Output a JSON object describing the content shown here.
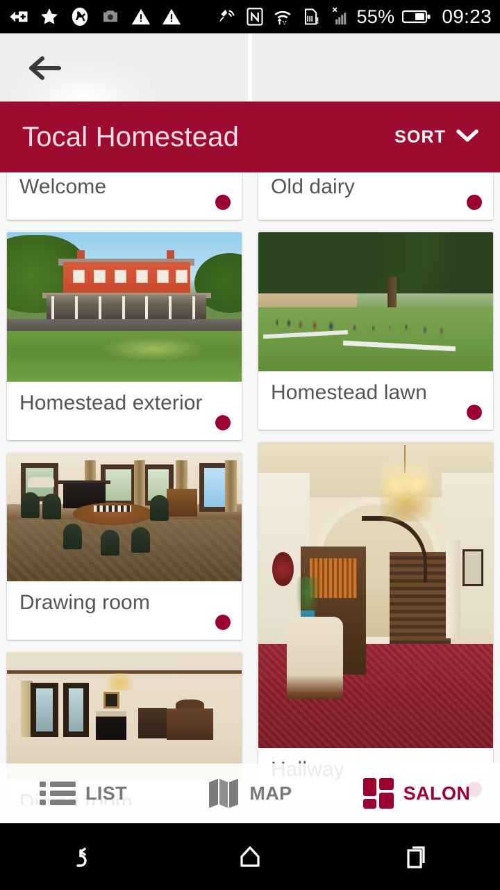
{
  "status_bar": {
    "left_icons": [
      "sim-card-add-icon",
      "star-icon",
      "do-not-disturb-icon",
      "camera-icon",
      "warning-icon",
      "warning-icon"
    ],
    "right_icons": [
      "cast-screen-icon",
      "nfc-icon",
      "wifi-data-transfer-icon",
      "sd-card-alert-icon",
      "signal-no-service-icon"
    ],
    "battery_percent": "55%",
    "battery_icon": "battery-icon",
    "time": "09:23"
  },
  "top_bar": {
    "back_icon": "back-arrow-icon"
  },
  "header": {
    "title": "Tocal Homestead",
    "sort_label": "SORT",
    "sort_icon": "chevron-down-icon",
    "background_color": "#9d0b2f"
  },
  "theme": {
    "accent": "#9b0030",
    "header": "#9d0b2f",
    "page_background": "#f7f7f7",
    "card_background": "#ffffff",
    "card_title_color": "#555555",
    "tab_inactive_color": "#787878"
  },
  "grid": {
    "left_column": [
      {
        "title": "Welcome",
        "photo": "generic",
        "dot_color": "#9b0030",
        "partial": true
      },
      {
        "title": "Homestead exterior",
        "photo": "homestead-exterior",
        "dot_color": "#9b0030",
        "photo_height": 215
      },
      {
        "title": "Drawing room",
        "photo": "drawing-room",
        "dot_color": "#9b0030",
        "photo_height": 185
      },
      {
        "title": "Dining room",
        "photo": "dining-room",
        "dot_color": "#9b0030",
        "photo_height": 185,
        "clipped_bottom": true
      }
    ],
    "right_column": [
      {
        "title": "Old dairy",
        "photo": "generic",
        "dot_color": "#9b0030",
        "partial": true
      },
      {
        "title": "Homestead lawn",
        "photo": "homestead-lawn",
        "dot_color": "#9b0030",
        "photo_height": 200
      },
      {
        "title": "Hallway",
        "photo": "hallway",
        "dot_color": "#9b0030",
        "photo_height": 440,
        "clipped_bottom": true
      }
    ]
  },
  "tab_bar": {
    "tabs": [
      {
        "label": "LIST",
        "icon": "list-icon",
        "active": false
      },
      {
        "label": "MAP",
        "icon": "map-icon",
        "active": false
      },
      {
        "label": "SALON",
        "icon": "salon-grid-icon",
        "active": true
      }
    ]
  },
  "android_nav": {
    "buttons": [
      {
        "name": "back",
        "icon": "android-back-icon"
      },
      {
        "name": "home",
        "icon": "android-home-icon"
      },
      {
        "name": "recents",
        "icon": "android-recents-icon"
      }
    ]
  }
}
